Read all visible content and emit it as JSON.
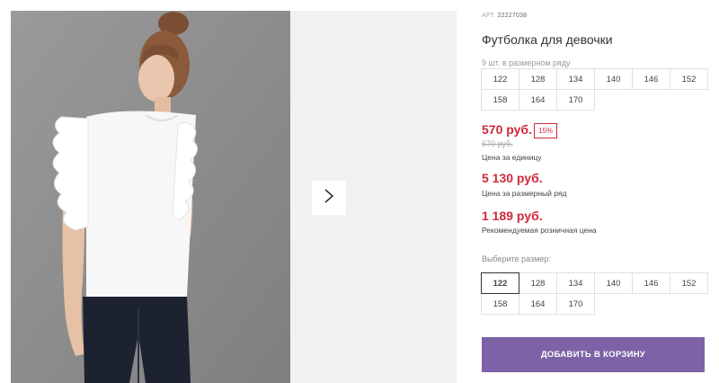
{
  "product": {
    "art_label": "АРТ.",
    "art_number": "22227038",
    "title": "Футболка для девочки",
    "row_note": "9 шт. в размерном ряду"
  },
  "size_row": [
    "122",
    "128",
    "134",
    "140",
    "146",
    "152",
    "158",
    "164",
    "170"
  ],
  "prices": {
    "unit_price": "570 руб.",
    "discount": "15%",
    "old_price": "670 руб.",
    "unit_label": "Цена за единицу",
    "row_price": "5 130 руб.",
    "row_label": "Цена за размерный ряд",
    "retail_price": "1 189 руб.",
    "retail_label": "Рекомендуемая розничная цена"
  },
  "size_select": {
    "label": "Выберите размер:",
    "sizes": [
      "122",
      "128",
      "134",
      "140",
      "146",
      "152",
      "158",
      "164",
      "170"
    ],
    "selected": "122"
  },
  "cart": {
    "add_label": "ДОБАВИТЬ В КОРЗИНУ"
  },
  "colors": {
    "accent": "#7d62a8",
    "price": "#d0293a"
  },
  "icons": {
    "next": "chevron-right-icon"
  }
}
